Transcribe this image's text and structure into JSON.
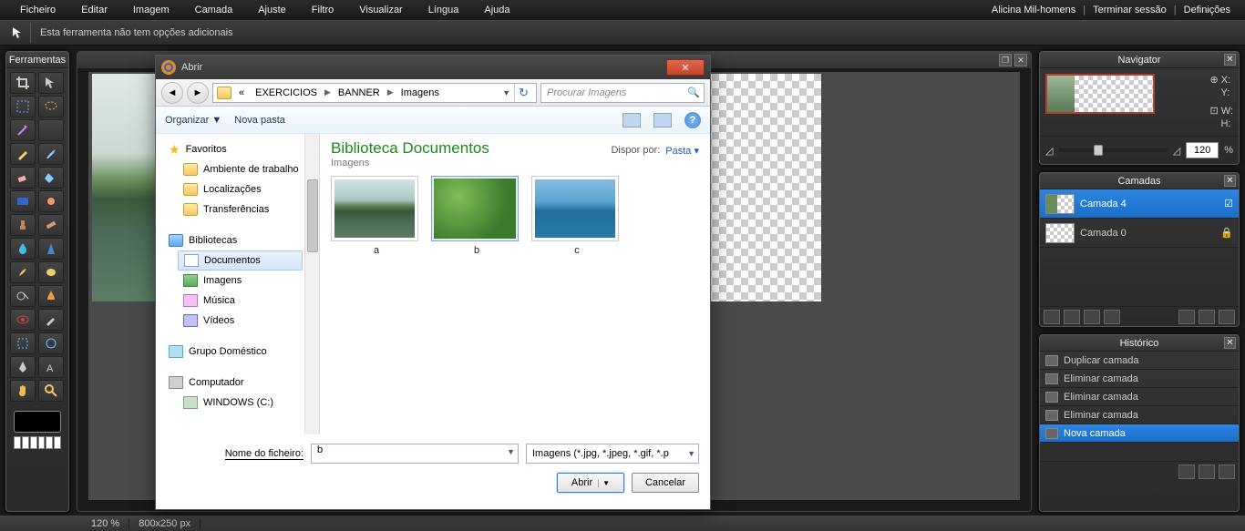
{
  "menubar": {
    "items": [
      "Ficheiro",
      "Editar",
      "Imagem",
      "Camada",
      "Ajuste",
      "Filtro",
      "Visualizar",
      "Língua",
      "Ajuda"
    ],
    "user": "Alicina Mil-homens",
    "signout": "Terminar sessão",
    "settings": "Definições"
  },
  "optbar": {
    "msg": "Esta ferramenta não tem opções adicionais"
  },
  "panels": {
    "tools": "Ferramentas",
    "navigator": "Navigator",
    "layers": "Camadas",
    "history": "Histórico"
  },
  "navigator": {
    "x": "X:",
    "y": "Y:",
    "w": "W:",
    "h": "H:",
    "zoom": "120",
    "pct": "%"
  },
  "layers": {
    "items": [
      {
        "name": "Camada 4",
        "selected": true,
        "filled": true
      },
      {
        "name": "Camada 0",
        "selected": false,
        "filled": false
      }
    ]
  },
  "history": {
    "items": [
      "Duplicar camada",
      "Eliminar camada",
      "Eliminar camada",
      "Eliminar camada",
      "Nova camada"
    ],
    "selected_index": 4
  },
  "status": {
    "zoom": "120 %",
    "size": "800x250 px"
  },
  "dialog": {
    "title": "Abrir",
    "breadcrumbs": [
      "EXERCICIOS",
      "BANNER",
      "Imagens"
    ],
    "crumb_prefix": "«",
    "search_placeholder": "Procurar Imagens",
    "organize": "Organizar",
    "arrow": "▼",
    "newfolder": "Nova pasta",
    "sidebar": {
      "favorites": "Favoritos",
      "fav_items": [
        "Ambiente de trabalho",
        "Localizações",
        "Transferências"
      ],
      "libraries": "Bibliotecas",
      "lib_items": [
        "Documentos",
        "Imagens",
        "Música",
        "Vídeos"
      ],
      "lib_selected": "Documentos",
      "homegroup": "Grupo Doméstico",
      "computer": "Computador",
      "drive": "WINDOWS (C:)"
    },
    "main": {
      "lib_title": "Biblioteca Documentos",
      "lib_sub": "Imagens",
      "arrange_label": "Dispor por:",
      "arrange_value": "Pasta",
      "files": [
        "a",
        "b",
        "c"
      ],
      "selected_file": "b"
    },
    "filename_label": "Nome do ficheiro:",
    "filename_underline": "N",
    "filename_value": "b",
    "filetype": "Imagens (*.jpg, *.jpeg, *.gif, *.p",
    "open": "Abrir",
    "cancel": "Cancelar"
  }
}
